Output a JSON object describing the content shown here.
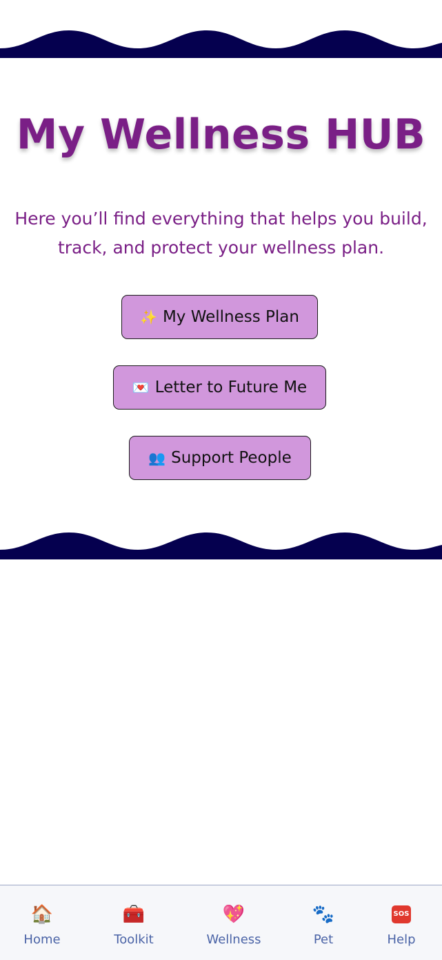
{
  "colors": {
    "wave": "#05004f",
    "title": "#7a1f86",
    "button_bg": "#d197dc",
    "tab_label": "#4a63a6"
  },
  "header": {
    "title": "My Wellness HUB",
    "subtitle": "Here you’ll find everything that helps you build, track, and protect your wellness plan."
  },
  "buttons": [
    {
      "icon": "sparkles-icon",
      "glyph": "✨",
      "label": "My Wellness Plan"
    },
    {
      "icon": "love-letter-icon",
      "glyph": "💌",
      "label": "Letter to Future Me"
    },
    {
      "icon": "people-icon",
      "glyph": "👥",
      "label": "Support People"
    }
  ],
  "tabbar": {
    "items": [
      {
        "icon": "house-icon",
        "glyph": "🏠",
        "label": "Home"
      },
      {
        "icon": "toolbox-icon",
        "glyph": "🧰",
        "label": "Toolkit"
      },
      {
        "icon": "sparkling-heart-icon",
        "glyph": "💖",
        "label": "Wellness"
      },
      {
        "icon": "paw-prints-icon",
        "glyph": "🐾",
        "label": "Pet"
      },
      {
        "icon": "sos-icon",
        "glyph": "SOS",
        "label": "Help"
      }
    ]
  }
}
